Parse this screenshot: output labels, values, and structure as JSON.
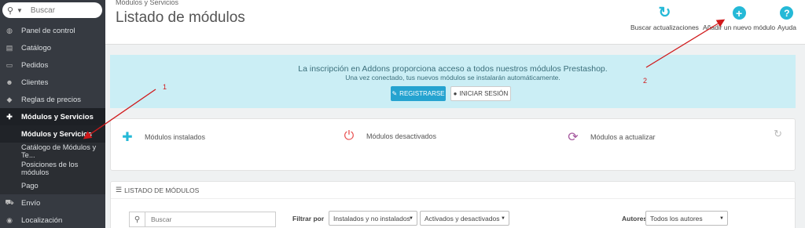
{
  "sidebar": {
    "search_placeholder": "Buscar",
    "items": [
      {
        "label": "Panel de control",
        "icon": "dashboard-icon",
        "glyph": "◍"
      },
      {
        "label": "Catálogo",
        "icon": "catalog-icon",
        "glyph": "▤"
      },
      {
        "label": "Pedidos",
        "icon": "orders-icon",
        "glyph": "▭"
      },
      {
        "label": "Clientes",
        "icon": "customers-icon",
        "glyph": "☻"
      },
      {
        "label": "Reglas de precios",
        "icon": "price-rules-icon",
        "glyph": "◆"
      },
      {
        "label": "Módulos y Servicios",
        "icon": "puzzle-icon",
        "glyph": "✚"
      },
      {
        "label": "Envío",
        "icon": "shipping-icon",
        "glyph": "⛟"
      },
      {
        "label": "Localización",
        "icon": "globe-icon",
        "glyph": "◉"
      }
    ],
    "sub_items": [
      {
        "label": "Módulos y Servicios"
      },
      {
        "label": "Catálogo de Módulos y Te..."
      },
      {
        "label": "Posiciones de los módulos"
      },
      {
        "label": "Pago"
      }
    ]
  },
  "header": {
    "breadcrumb": "Módulos y Servicios",
    "title": "Listado de módulos",
    "toolbar": [
      {
        "label": "Buscar actualizaciones",
        "icon": "refresh-icon",
        "glyph": "↻",
        "color": "#25b9d7"
      },
      {
        "label": "Añadir un nuevo módulo",
        "icon": "add-circle-icon",
        "glyph": "+",
        "color": "#25b9d7"
      },
      {
        "label": "Ayuda",
        "icon": "help-icon",
        "glyph": "?",
        "color": "#25b9d7"
      }
    ]
  },
  "banner": {
    "title": "La inscripción en Addons proporciona acceso a todos nuestros módulos Prestashop.",
    "subtitle": "Una vez conectado, tus nuevos módulos se instalarán automáticamente.",
    "register_label": "REGISTRARSE",
    "login_label": "INICIAR SESIÓN"
  },
  "stats": {
    "installed_label": "Módulos instalados",
    "disabled_label": "Módulos desactivados",
    "to_update_label": "Módulos a actualizar"
  },
  "listing": {
    "heading": "Listado de módulos",
    "search_placeholder": "Buscar",
    "filter_label": "Filtrar por",
    "filter_install": "Instalados y no instalados",
    "filter_active": "Activados y desactivados",
    "authors_label": "Autores",
    "authors_value": "Todos los autores"
  },
  "annotations": {
    "one": "1",
    "two": "2"
  },
  "colors": {
    "accent": "#25b9d7",
    "sidebar_bg": "#363a41",
    "banner_bg": "#cbeef5",
    "annotation": "#d0191b"
  }
}
